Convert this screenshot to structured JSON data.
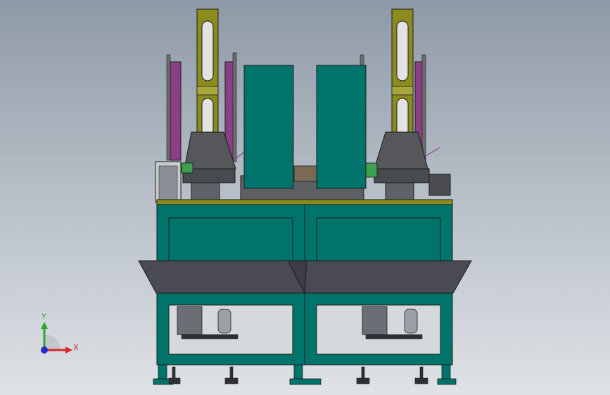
{
  "viewport": {
    "colors": {
      "background_top": "#8e9aa7",
      "background_bottom": "#dfe2e6",
      "frame_teal": "#00736b",
      "frame_edge": "#1b1b1b",
      "mast_olive": "#8c8c1e",
      "panel_purple": "#8a3f86",
      "hopper_gray": "#4a4a55",
      "base_gray": "#55575b",
      "floor_green": "#4cc24c"
    }
  },
  "triad": {
    "x_label": "X",
    "y_label": "Y",
    "x_color": "#d42a2a",
    "y_color": "#2aa52a",
    "origin_color": "#2a2acb"
  }
}
